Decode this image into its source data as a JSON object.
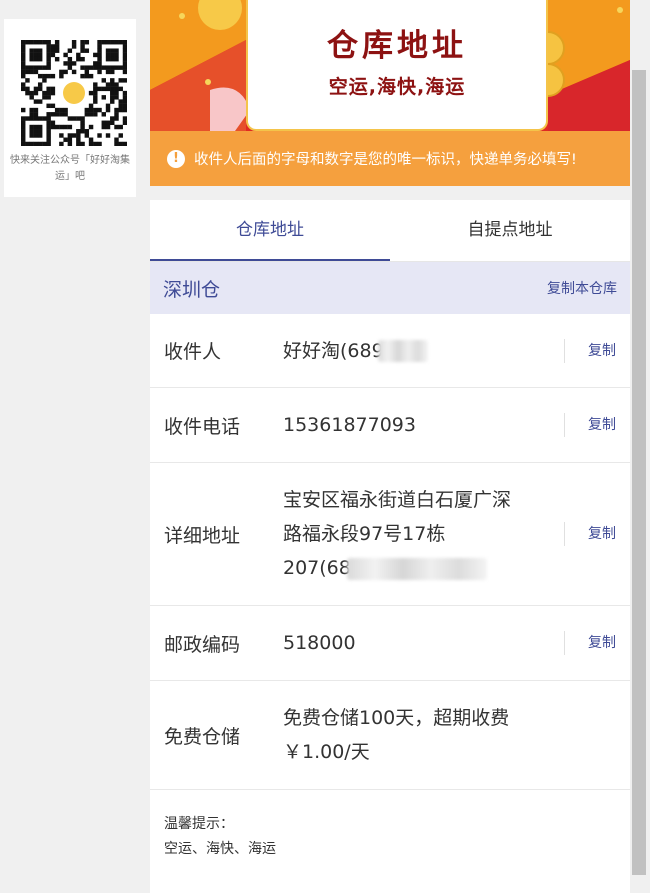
{
  "qr": {
    "caption": "快来关注公众号「好好淘集运」吧"
  },
  "banner": {
    "title": "仓库地址",
    "subtitle": "空运,海快,海运"
  },
  "notice": {
    "text": "收件人后面的字母和数字是您的唯一标识，快递单务必填写!"
  },
  "tabs": [
    {
      "label": "仓库地址",
      "active": true
    },
    {
      "label": "自提点地址",
      "active": false
    }
  ],
  "warehouse": {
    "name": "深圳仓",
    "copy_label": "复制本仓库"
  },
  "fields": {
    "recipient": {
      "label": "收件人",
      "value": "好好淘(689",
      "copy": "复制"
    },
    "phone": {
      "label": "收件电话",
      "value": "15361877093",
      "copy": "复制"
    },
    "address": {
      "label": "详细地址",
      "line1": "宝安区福永街道白石厦广深",
      "line2": "路福永段97号17栋",
      "line3": "207(68",
      "copy": "复制"
    },
    "postcode": {
      "label": "邮政编码",
      "value": "518000",
      "copy": "复制"
    },
    "storage": {
      "label": "免费仓储",
      "line1": "免费仓储100天，超期收费",
      "line2": "￥1.00/天"
    }
  },
  "tips": {
    "title": "温馨提示：",
    "text": "空运、海快、海运"
  },
  "colors": {
    "accent": "#3f4b96",
    "notice": "#f5a03e",
    "banner_red": "#e02a22",
    "banner_orange": "#f39a1e",
    "title_red": "#8d1212"
  }
}
